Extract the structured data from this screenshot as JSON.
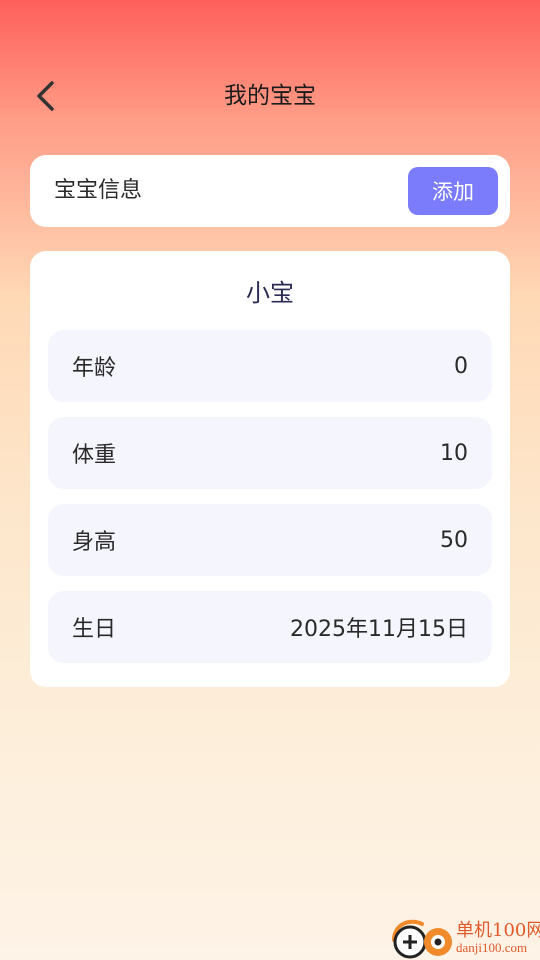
{
  "header": {
    "title": "我的宝宝",
    "back_icon": "chevron-left-icon"
  },
  "baby_info": {
    "label": "宝宝信息",
    "add_label": "添加",
    "add_color": "#7b7cfb"
  },
  "baby": {
    "name": "小宝",
    "rows": [
      {
        "label": "年龄",
        "value": "0"
      },
      {
        "label": "体重",
        "value": "10"
      },
      {
        "label": "身高",
        "value": "50"
      },
      {
        "label": "生日",
        "value": "2025年11月15日"
      }
    ]
  },
  "watermark": {
    "name": "单机100网",
    "url": "danji100.com"
  }
}
